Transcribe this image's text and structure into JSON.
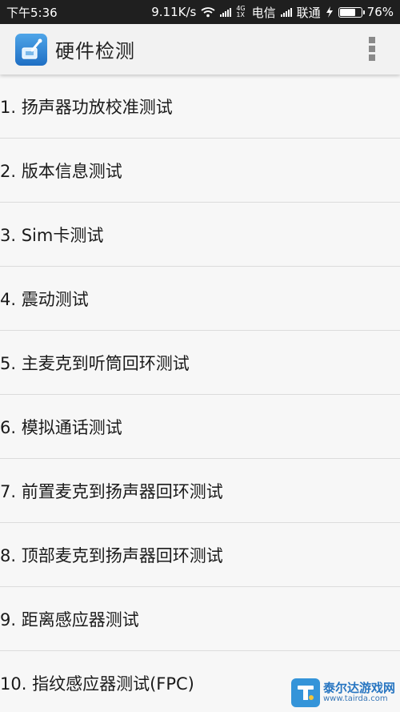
{
  "status_bar": {
    "time": "下午5:36",
    "speed": "9.11K/s",
    "network_small_top": "4G",
    "network_small_bottom": "1X",
    "carrier1": "电信",
    "carrier2": "联通",
    "battery_text": "76%",
    "battery_level": 0.76,
    "icons": [
      "wifi-icon",
      "signal-icon",
      "charging-icon",
      "battery-icon"
    ]
  },
  "app_bar": {
    "title": "硬件检测",
    "icon": "hardware-test-app-icon",
    "menu_icon": "overflow-menu-icon"
  },
  "list": {
    "items": [
      {
        "label": "1. 扬声器功放校准测试"
      },
      {
        "label": "2. 版本信息测试"
      },
      {
        "label": "3. Sim卡测试"
      },
      {
        "label": "4. 震动测试"
      },
      {
        "label": "5. 主麦克到听筒回环测试"
      },
      {
        "label": "6. 模拟通话测试"
      },
      {
        "label": "7. 前置麦克到扬声器回环测试"
      },
      {
        "label": "8. 顶部麦克到扬声器回环测试"
      },
      {
        "label": "9. 距离感应器测试"
      },
      {
        "label": "10. 指纹感应器测试(FPC)"
      }
    ]
  },
  "watermark": {
    "name": "泰尔达游戏网",
    "url": "www.tairda.com"
  },
  "colors": {
    "status_bar_bg": "#1f1f1f",
    "app_bar_bg": "#f2f2f2",
    "list_bg": "#f7f7f7",
    "divider": "#dcdcdc",
    "watermark_blue": "#1c6fbf"
  }
}
